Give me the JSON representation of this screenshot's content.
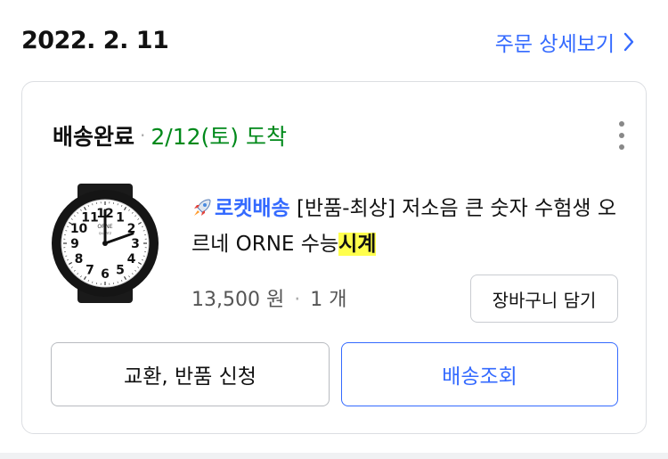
{
  "order": {
    "date": "2022. 2. 11",
    "detail_link_label": "주문 상세보기"
  },
  "shipment": {
    "status": "배송완료",
    "separator": "·",
    "arrival": "2/12(토) 도착"
  },
  "product": {
    "rocket_label": "로켓배송",
    "title_main": " [반품-최상] 저소음 큰 숫자 수험생 오르네 ORNE 수능",
    "title_highlight": "시계",
    "price": "13,500 원",
    "quantity": "1 개",
    "watch_brand": "ORNE",
    "watch_sub": "QUARTZ",
    "watch_numbers": [
      "12",
      "1",
      "2",
      "3",
      "4",
      "5",
      "6",
      "7",
      "8",
      "9",
      "10",
      "11"
    ]
  },
  "buttons": {
    "cart": "장바구니 담기",
    "return": "교환, 반품 신청",
    "tracking": "배송조회"
  },
  "colors": {
    "accent_blue": "#346aff",
    "status_green": "#00891a",
    "highlight_yellow": "#ffff4d"
  },
  "icons": [
    "chevron-right-icon",
    "more-vertical-icon",
    "rocket-icon"
  ]
}
